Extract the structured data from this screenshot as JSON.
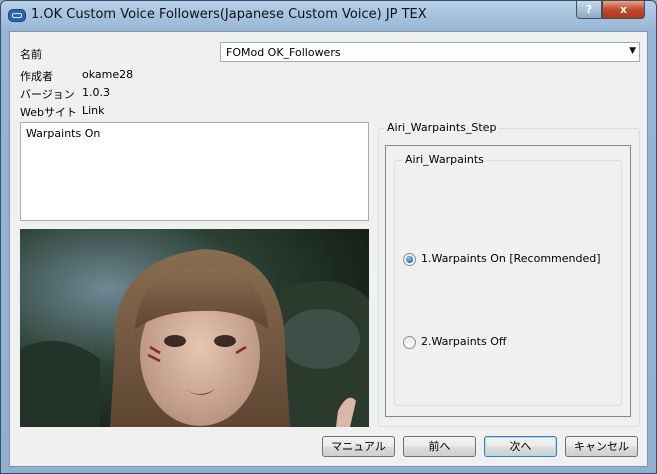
{
  "window": {
    "title": "1.OK Custom Voice Followers(Japanese Custom Voice) JP TEX",
    "help_label": "?",
    "close_label": "x"
  },
  "info": {
    "name_label": "名前",
    "name_value": "FOMod OK_Followers",
    "author_label": "作成者",
    "author_value": "okame28",
    "version_label": "バージョン",
    "version_value": "1.0.3",
    "website_label": "Webサイト",
    "website_value": "Link"
  },
  "description": "Warpaints On",
  "step": {
    "title": "Airi_Warpaints_Step",
    "group": {
      "title": "Airi_Warpaints",
      "options": [
        {
          "label": "1.Warpaints On [Recommended]",
          "selected": true
        },
        {
          "label": "2.Warpaints Off",
          "selected": false
        }
      ]
    }
  },
  "buttons": {
    "manual": "マニュアル",
    "back": "前へ",
    "next": "次へ",
    "cancel": "キャンセル"
  },
  "colors": {
    "accent": "#3c7fb1",
    "close": "#c44a2d"
  }
}
